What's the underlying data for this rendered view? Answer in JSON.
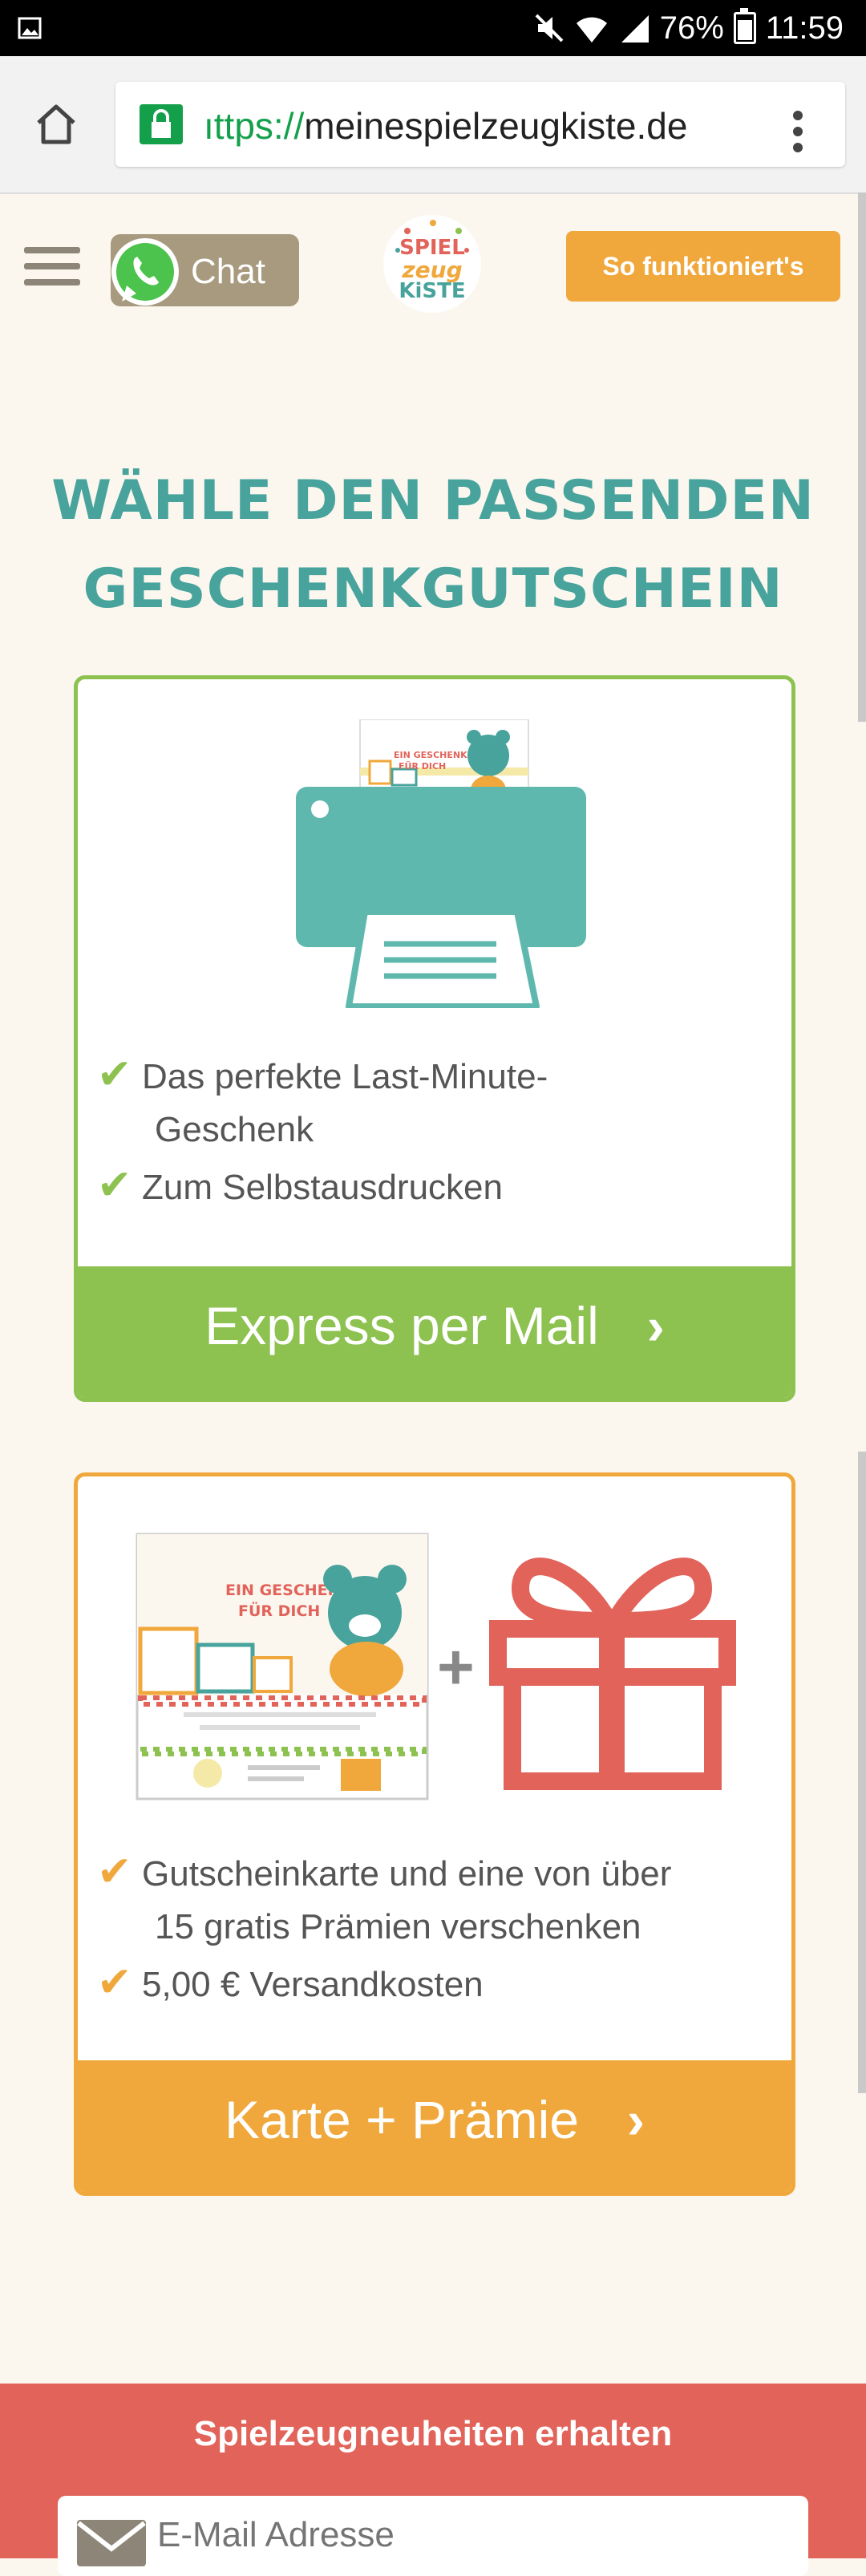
{
  "status_bar": {
    "battery": "76%",
    "time": "11:59",
    "icons": [
      "image-icon",
      "mute-icon",
      "wifi-icon",
      "signal-icon",
      "battery-icon"
    ]
  },
  "browser": {
    "url_scheme": "ıttps://",
    "url_host": "meinespielzeugkiste.de"
  },
  "header": {
    "chat_label": "Chat",
    "logo_line1": "SPIEL",
    "logo_line2": "zeug",
    "logo_line3": "KiSTE",
    "how_it_works": "So funktioniert's"
  },
  "headline": {
    "line1": "WÄHLE DEN PASSENDEN",
    "line2": "GESCHENKGUTSCHEIN"
  },
  "cards": [
    {
      "features": [
        "Das perfekte Last-Minute-",
        "Geschenk",
        "Zum Selbstausdrucken"
      ],
      "button": "Express per Mail",
      "illustration_text": [
        "EIN GESCHENK",
        "FÜR DICH"
      ]
    },
    {
      "features": [
        "Gutscheinkarte und eine von über",
        "15 gratis Prämien verschenken",
        "5,00 € Versandkosten"
      ],
      "button": "Karte + Prämie",
      "illustration_text": [
        "EIN GESCHENK",
        "FÜR DICH"
      ],
      "plus": "+"
    }
  ],
  "newsletter": {
    "title": "Spielzeugneuheiten erhalten",
    "placeholder": "E-Mail Adresse"
  },
  "colors": {
    "teal": "#47a39c",
    "green": "#8dc250",
    "orange": "#f0a83c",
    "red": "#e1635a",
    "background": "#fbf7ef"
  }
}
